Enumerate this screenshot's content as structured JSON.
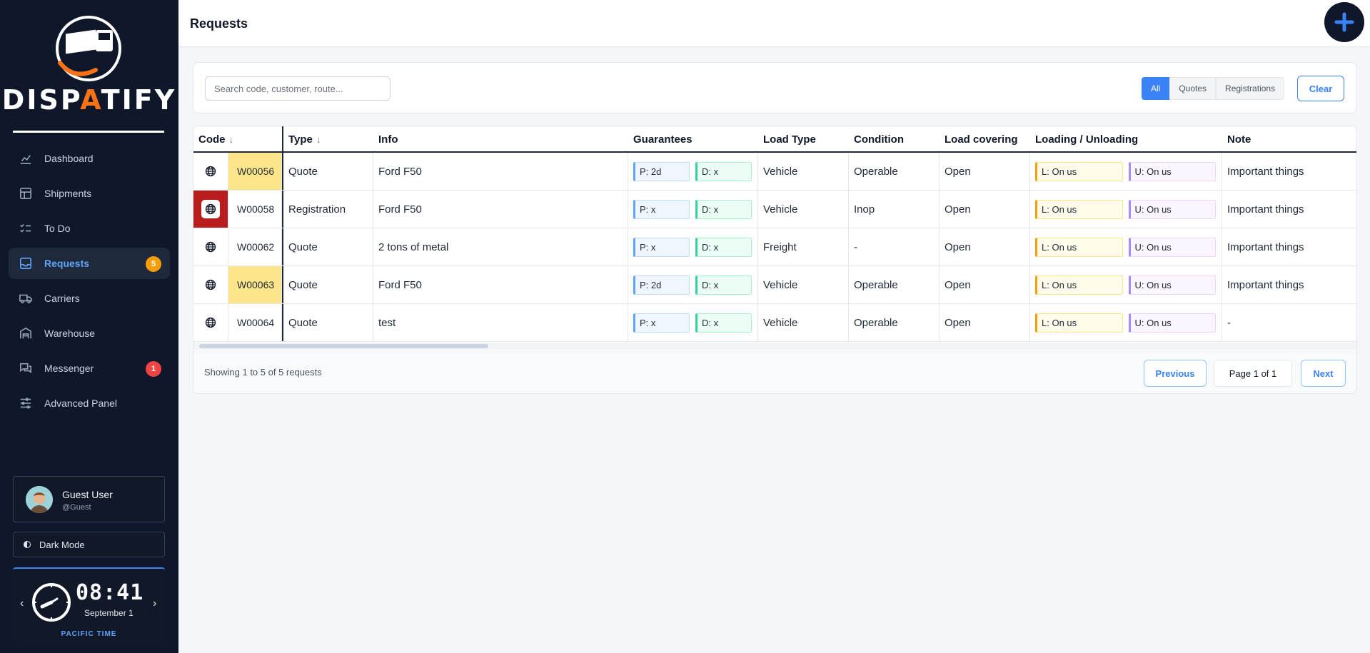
{
  "brand": {
    "name_part1": "DISP",
    "name_accent": "A",
    "name_part2": "TIFY"
  },
  "sidebar": {
    "items": [
      {
        "label": "Dashboard",
        "icon": "chart-icon"
      },
      {
        "label": "Shipments",
        "icon": "box-icon"
      },
      {
        "label": "To Do",
        "icon": "checklist-icon"
      },
      {
        "label": "Requests",
        "icon": "inbox-icon",
        "badge": "5",
        "active": true
      },
      {
        "label": "Carriers",
        "icon": "truck-icon"
      },
      {
        "label": "Warehouse",
        "icon": "warehouse-icon"
      },
      {
        "label": "Messenger",
        "icon": "chat-icon",
        "badge": "1"
      },
      {
        "label": "Advanced Panel",
        "icon": "sliders-icon"
      }
    ],
    "user": {
      "name": "Guest User",
      "handle": "@Guest"
    },
    "dark_mode_label": "Dark Mode",
    "clock": {
      "time": "08:41",
      "date": "September 1",
      "timezone": "PACIFIC TIME",
      "prev": "‹",
      "next": "›"
    }
  },
  "header": {
    "title": "Requests",
    "add_icon": "plus-icon"
  },
  "filters": {
    "search_placeholder": "Search code, customer, route...",
    "segments": [
      "All",
      "Quotes",
      "Registrations"
    ],
    "active_segment": "All",
    "clear_label": "Clear"
  },
  "table": {
    "columns": [
      "Code",
      "Type",
      "Info",
      "Guarantees",
      "Load Type",
      "Condition",
      "Load covering",
      "Loading / Unloading",
      "Note"
    ],
    "sort_arrow": "↓",
    "rows": [
      {
        "code": "W00056",
        "highlight": "yellow",
        "type": "Quote",
        "info": "Ford F50",
        "pickup": "P: 2d",
        "delivery": "D: x",
        "load_type": "Vehicle",
        "condition": "Operable",
        "covering": "Open",
        "loading": "L: On us",
        "unloading": "U: On us",
        "note": "Important things"
      },
      {
        "code": "W00058",
        "highlight": "red-icon",
        "type": "Registration",
        "info": "Ford F50",
        "pickup": "P: x",
        "delivery": "D: x",
        "load_type": "Vehicle",
        "condition": "Inop",
        "covering": "Open",
        "loading": "L: On us",
        "unloading": "U: On us",
        "note": "Important things"
      },
      {
        "code": "W00062",
        "highlight": "none",
        "type": "Quote",
        "info": "2 tons of metal",
        "pickup": "P: x",
        "delivery": "D: x",
        "load_type": "Freight",
        "condition": "-",
        "covering": "Open",
        "loading": "L: On us",
        "unloading": "U: On us",
        "note": "Important things"
      },
      {
        "code": "W00063",
        "highlight": "yellow",
        "type": "Quote",
        "info": "Ford F50",
        "pickup": "P: 2d",
        "delivery": "D: x",
        "load_type": "Vehicle",
        "condition": "Operable",
        "covering": "Open",
        "loading": "L: On us",
        "unloading": "U: On us",
        "note": "Important things"
      },
      {
        "code": "W00064",
        "highlight": "none",
        "type": "Quote",
        "info": "test",
        "pickup": "P: x",
        "delivery": "D: x",
        "load_type": "Vehicle",
        "condition": "Operable",
        "covering": "Open",
        "loading": "L: On us",
        "unloading": "U: On us",
        "note": "-"
      }
    ]
  },
  "pagination": {
    "summary": "Showing 1 to 5 of 5 requests",
    "previous": "Previous",
    "page_label": "Page 1 of 1",
    "next": "Next"
  },
  "colors": {
    "sidebar_bg": "#0f172a",
    "accent": "#3b82f6",
    "brand_orange": "#f97316",
    "highlight_yellow": "#fde68a",
    "highlight_red": "#b91c1c"
  }
}
